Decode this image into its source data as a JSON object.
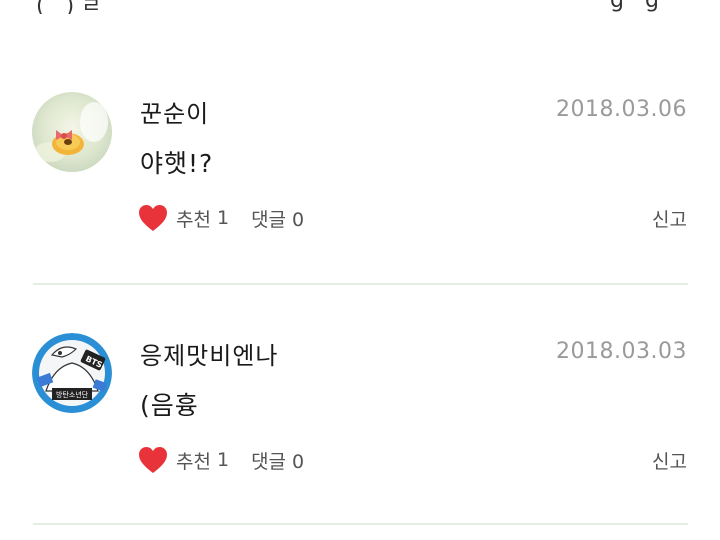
{
  "comments": [
    {
      "name": "꾼순이",
      "date": "2018.03.06",
      "text": "야햇!?",
      "like_label": "추천",
      "like_count": "1",
      "reply_label": "댓글",
      "reply_count": "0",
      "report_label": "신고"
    },
    {
      "name": "응제맛비엔나",
      "date": "2018.03.03",
      "text": "(음흉",
      "like_label": "추천",
      "like_count": "1",
      "reply_label": "댓글",
      "reply_count": "0",
      "report_label": "신고"
    }
  ],
  "avatar2_badge": "BTS",
  "avatar2_banner": "방탄소년단",
  "colors": {
    "heart": "#e8333b",
    "divider": "#e3efe5",
    "date": "#9a9a9a"
  }
}
